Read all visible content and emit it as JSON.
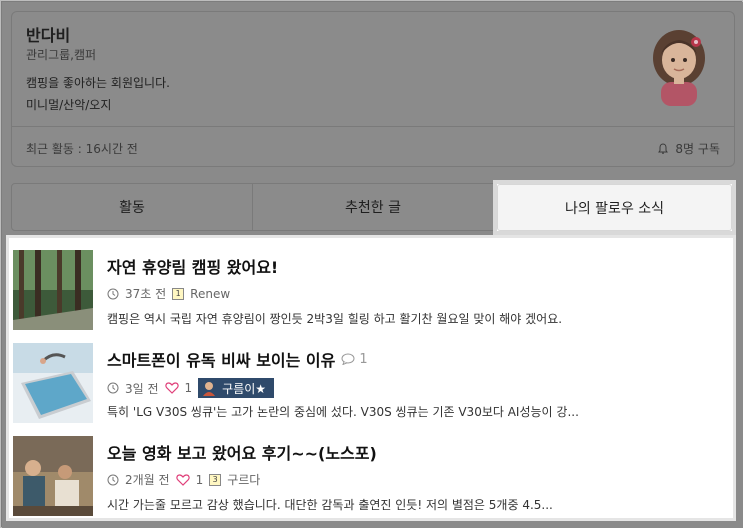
{
  "profile": {
    "name": "반다비",
    "group": "관리그룹,캠퍼",
    "desc_line1": "캠핑을 좋아하는 회원입니다.",
    "desc_line2": "미니멀/산악/오지",
    "activity": "최근 활동 : 16시간 전",
    "followers": "8명 구독"
  },
  "tabs": [
    {
      "label": "활동"
    },
    {
      "label": "추천한 글"
    },
    {
      "label": "나의 팔로우 소식"
    }
  ],
  "posts": [
    {
      "title": "자연 휴양림 캠핑 왔어요!",
      "time": "37초 전",
      "author": "Renew",
      "summary": "캠핑은 역시 국립 자연 휴양림이 짱인듯 2박3일 힐링 하고 활기찬 월요일 맞이 해야 겠어요."
    },
    {
      "title": "스마트폰이 유독 비싸 보이는 이유",
      "comments": "1",
      "time": "3일 전",
      "likes": "1",
      "author": "구름이★",
      "summary": "특히 'LG V30S 씽큐'는 고가 논란의 중심에 섰다. V30S 씽큐는 기존 V30보다 AI성능이 강..."
    },
    {
      "title": "오늘 영화 보고 왔어요 후기~~(노스포)",
      "time": "2개월 전",
      "likes": "1",
      "author": "구르다",
      "summary": "시간 가는줄 모르고 감상 했습니다. 대단한 감독과 출연진 인듯! 저의 별점은 5개중 4.5..."
    }
  ],
  "icons": {
    "clock": "clock-icon",
    "heart": "heart-icon",
    "comment": "comment-icon",
    "bell": "bell-icon"
  },
  "colors": {
    "author_badge": "#2f4a6b",
    "heart": "#e0407a",
    "overlay": "#8a8a8a"
  }
}
